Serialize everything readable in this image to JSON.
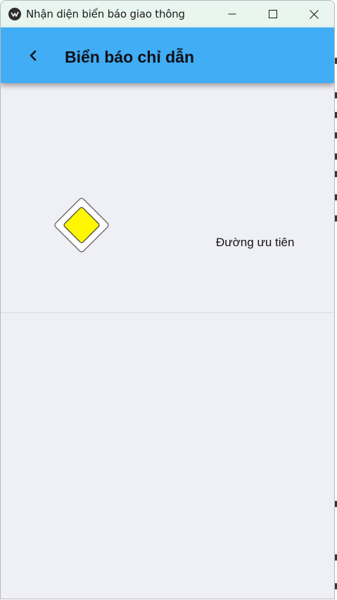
{
  "window": {
    "title": "Nhận diện biển báo giao thông",
    "controls": [
      "minimize",
      "maximize",
      "close"
    ]
  },
  "appbar": {
    "title": "Biển báo chỉ dẫn",
    "back_icon": "chevron-left-icon",
    "color": "#40adf5"
  },
  "signs": [
    {
      "icon": "priority-road-sign-icon",
      "label": "Đường ưu tiên",
      "fill_color": "#fff700"
    }
  ]
}
